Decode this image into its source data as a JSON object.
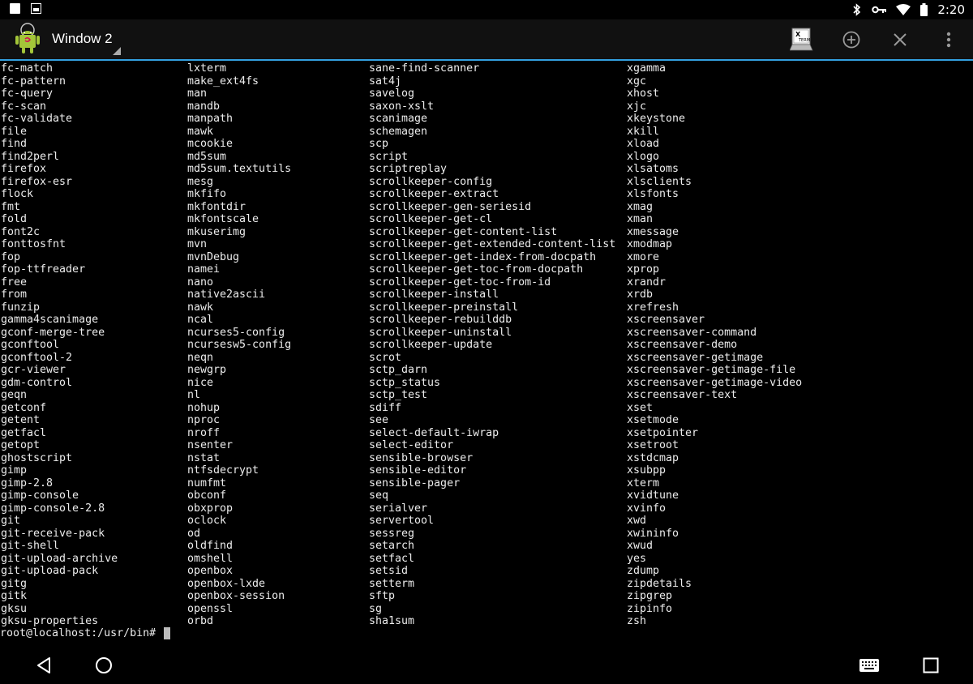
{
  "status_bar": {
    "time": "2:20",
    "icons": [
      "notification-square-icon",
      "screenshot-icon",
      "bluetooth-icon",
      "vpn-key-icon",
      "wifi-icon",
      "battery-icon"
    ]
  },
  "action_bar": {
    "title": "Window 2",
    "xterm_badge": "X TERM",
    "accent_color": "#33a0e0"
  },
  "terminal": {
    "columns": [
      [
        "fc-match",
        "fc-pattern",
        "fc-query",
        "fc-scan",
        "fc-validate",
        "file",
        "find",
        "find2perl",
        "firefox",
        "firefox-esr",
        "flock",
        "fmt",
        "fold",
        "font2c",
        "fonttosfnt",
        "fop",
        "fop-ttfreader",
        "free",
        "from",
        "funzip",
        "gamma4scanimage",
        "gconf-merge-tree",
        "gconftool",
        "gconftool-2",
        "gcr-viewer",
        "gdm-control",
        "geqn",
        "getconf",
        "getent",
        "getfacl",
        "getopt",
        "ghostscript",
        "gimp",
        "gimp-2.8",
        "gimp-console",
        "gimp-console-2.8",
        "git",
        "git-receive-pack",
        "git-shell",
        "git-upload-archive",
        "git-upload-pack",
        "gitg",
        "gitk",
        "gksu",
        "gksu-properties"
      ],
      [
        "lxterm",
        "make_ext4fs",
        "man",
        "mandb",
        "manpath",
        "mawk",
        "mcookie",
        "md5sum",
        "md5sum.textutils",
        "mesg",
        "mkfifo",
        "mkfontdir",
        "mkfontscale",
        "mkuserimg",
        "mvn",
        "mvnDebug",
        "namei",
        "nano",
        "native2ascii",
        "nawk",
        "ncal",
        "ncurses5-config",
        "ncursesw5-config",
        "neqn",
        "newgrp",
        "nice",
        "nl",
        "nohup",
        "nproc",
        "nroff",
        "nsenter",
        "nstat",
        "ntfsdecrypt",
        "numfmt",
        "obconf",
        "obxprop",
        "oclock",
        "od",
        "oldfind",
        "omshell",
        "openbox",
        "openbox-lxde",
        "openbox-session",
        "openssl",
        "orbd"
      ],
      [
        "sane-find-scanner",
        "sat4j",
        "savelog",
        "saxon-xslt",
        "scanimage",
        "schemagen",
        "scp",
        "script",
        "scriptreplay",
        "scrollkeeper-config",
        "scrollkeeper-extract",
        "scrollkeeper-gen-seriesid",
        "scrollkeeper-get-cl",
        "scrollkeeper-get-content-list",
        "scrollkeeper-get-extended-content-list",
        "scrollkeeper-get-index-from-docpath",
        "scrollkeeper-get-toc-from-docpath",
        "scrollkeeper-get-toc-from-id",
        "scrollkeeper-install",
        "scrollkeeper-preinstall",
        "scrollkeeper-rebuilddb",
        "scrollkeeper-uninstall",
        "scrollkeeper-update",
        "scrot",
        "sctp_darn",
        "sctp_status",
        "sctp_test",
        "sdiff",
        "see",
        "select-default-iwrap",
        "select-editor",
        "sensible-browser",
        "sensible-editor",
        "sensible-pager",
        "seq",
        "serialver",
        "servertool",
        "sessreg",
        "setarch",
        "setfacl",
        "setsid",
        "setterm",
        "sftp",
        "sg",
        "sha1sum"
      ],
      [
        "xgamma",
        "xgc",
        "xhost",
        "xjc",
        "xkeystone",
        "xkill",
        "xload",
        "xlogo",
        "xlsatoms",
        "xlsclients",
        "xlsfonts",
        "xmag",
        "xman",
        "xmessage",
        "xmodmap",
        "xmore",
        "xprop",
        "xrandr",
        "xrdb",
        "xrefresh",
        "xscreensaver",
        "xscreensaver-command",
        "xscreensaver-demo",
        "xscreensaver-getimage",
        "xscreensaver-getimage-file",
        "xscreensaver-getimage-video",
        "xscreensaver-text",
        "xset",
        "xsetmode",
        "xsetpointer",
        "xsetroot",
        "xstdcmap",
        "xsubpp",
        "xterm",
        "xvidtune",
        "xvinfo",
        "xwd",
        "xwininfo",
        "xwud",
        "yes",
        "zdump",
        "zipdetails",
        "zipgrep",
        "zipinfo",
        "zsh"
      ]
    ],
    "prompt": "root@localhost:/usr/bin# "
  },
  "nav_bar": {
    "icons": [
      "back-icon",
      "home-icon",
      "keyboard-icon",
      "recents-icon"
    ]
  }
}
